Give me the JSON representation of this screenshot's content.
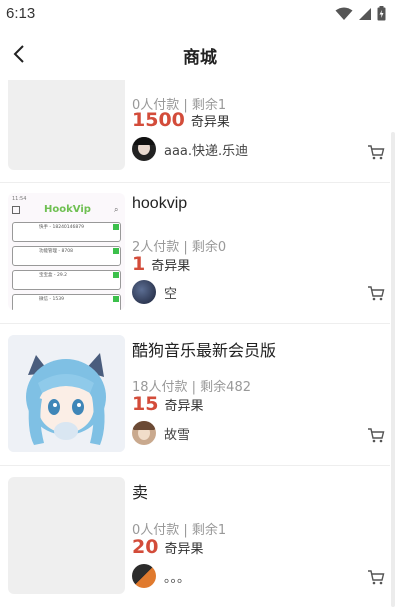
{
  "status_bar": {
    "time": "6:13"
  },
  "header": {
    "title": "商城"
  },
  "items": [
    {
      "title": "",
      "stats": "0人付款 | 剩余1",
      "price": "1500",
      "unit": "奇异果",
      "seller": "aaa.快递.乐迪"
    },
    {
      "title": "hookvip",
      "stats": "2人付款 | 剩余0",
      "price": "1",
      "unit": "奇异果",
      "seller": "空",
      "thumb_text": {
        "brand": "HookVip",
        "rows": [
          "快手 - 18240146879",
          "功能管理 - 8708",
          "宝宝盒 - 29.2",
          "微信 - 1539"
        ]
      }
    },
    {
      "title": "酷狗音乐最新会员版",
      "stats": "18人付款 | 剩余482",
      "price": "15",
      "unit": "奇异果",
      "seller": "故雪"
    },
    {
      "title": "卖",
      "stats": "0人付款 | 剩余1",
      "price": "20",
      "unit": "奇异果",
      "seller": "。。。"
    }
  ],
  "colors": {
    "price": "#d34c3a",
    "muted": "#999999",
    "placeholder": "#efefef",
    "accent_green": "#3cc04b"
  },
  "icons": [
    "wifi-icon",
    "signal-icon",
    "battery-icon",
    "back-arrow-icon",
    "cart-icon"
  ]
}
